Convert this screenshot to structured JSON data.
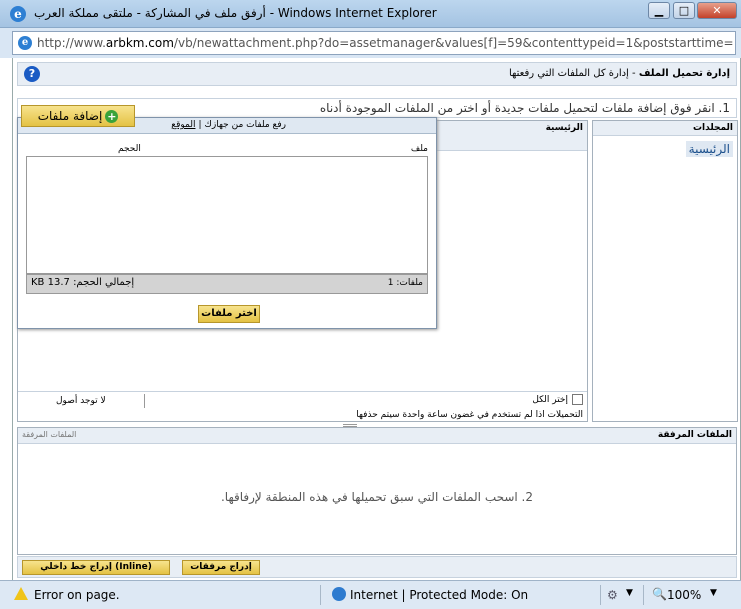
{
  "window": {
    "title": "أرفق ملف في المشاركة - ملتقى مملكة العرب - Windows Internet Explorer",
    "minimize": "▁",
    "maximize": "□",
    "close": "✕"
  },
  "address": {
    "url_prefix": "http://www.",
    "url_domain": "arbkm.com",
    "url_rest": "/vb/newattachment.php?do=assetmanager&values[f]=59&contenttypeid=1&poststarttime=1268693082&pc"
  },
  "header": {
    "title": "إدارة تحميل الملف",
    "separator": "-",
    "subtitle": "إدارة كل الملفات التي رفعتها",
    "help": "?"
  },
  "instruction1": "1. انقر فوق إضافة ملفات لتحميل ملفات جديدة أو اختر من الملفات الموجودة أدناه",
  "folders": {
    "header": "المجلدات",
    "root": "الرئيسية"
  },
  "main": {
    "title": "الرئيسية",
    "select_all": "إختر الكل",
    "no_assets": "لا توجد أصول",
    "cleanup_note": "التحميلات اذا لم تستخدم في غضون ساعة واحدة سيتم حذفها"
  },
  "upload": {
    "tab_computer": "رفع ملفات من جهازك",
    "tab_sep": "|",
    "tab_url": "الموقع",
    "add_files": "إضافة ملفات",
    "col_file": "ملف",
    "col_size": "الحجم",
    "files_count": "ملفات: 1",
    "total_size_label": "إجمالي الحجم:",
    "total_size_value": "13.7 KB",
    "choose_files": "اختر ملفات"
  },
  "attachments": {
    "title": "الملفات المرفقة",
    "title_faded": "الملفات المرفقة",
    "instruction2": "2. اسحب الملفات التي سبق تحميلها في هذه المنطقة لإرفاقها."
  },
  "buttons": {
    "insert_attachments": "إدراج مرفقات",
    "insert_inline": "إدراج خط داخلي (Inline)"
  },
  "status": {
    "error": "Error on page.",
    "zone": "Internet | Protected Mode: On",
    "zoom": "100%"
  }
}
